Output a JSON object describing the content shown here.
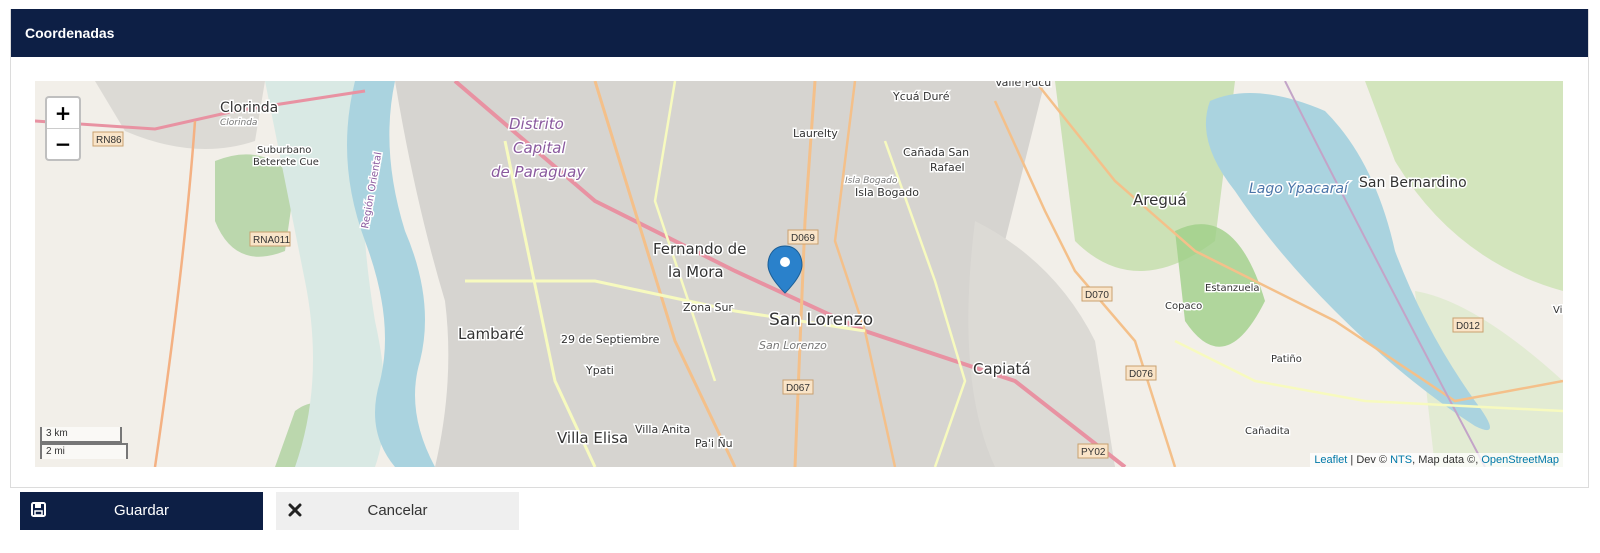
{
  "panel": {
    "title": "Coordenadas"
  },
  "map": {
    "zoom_in": "+",
    "zoom_out": "−",
    "scale_km": "3 km",
    "scale_mi": "2 mi",
    "attribution": {
      "leaflet": "Leaflet",
      "sep1": " | Dev © ",
      "nts": "NTS",
      "map_data": ", Map data ©, ",
      "osm": "OpenStreetMap"
    },
    "places": {
      "clorinda": "Clorinda",
      "clorinda_small": "Clorinda",
      "suburbano": "Suburbano",
      "beterete": "Beterete Cue",
      "distrito1": "Distrito",
      "distrito2": "Capital",
      "distrito3": "de Paraguay",
      "laurelty": "Laurelty",
      "ycua": "Ycuá Duré",
      "valle": "Valle Pucú",
      "canada1": "Cañada San",
      "canada2": "Rafael",
      "isla_small": "Isla Bogado",
      "isla": "Isla Bogado",
      "fdm1": "Fernando de",
      "fdm2": "la Mora",
      "zona_sur": "Zona Sur",
      "san_lorenzo": "San Lorenzo",
      "san_lorenzo_small": "San Lorenzo",
      "lambare": "Lambaré",
      "sep29": "29 de Septiembre",
      "ypati": "Ypati",
      "villa_elisa": "Villa Elisa",
      "villa_anita": "Villa Anita",
      "pai_nu": "Pa'i Ñu",
      "capiata": "Capiatá",
      "aregua": "Areguá",
      "copaco": "Copaco",
      "estanzuela": "Estanzuela",
      "lago": "Lago Ypacaraí",
      "san_bernardino": "San Bernardino",
      "patino": "Patiño",
      "canadita": "Cañadita",
      "region": "Región Oriental",
      "vi": "Vi"
    },
    "roads": {
      "rn86": "RN86",
      "rna011": "RNA011",
      "d069": "D069",
      "d070": "D070",
      "d076": "D076",
      "d067": "D067",
      "d012": "D012",
      "py02": "PY02"
    }
  },
  "buttons": {
    "save": "Guardar",
    "cancel": "Cancelar"
  },
  "colors": {
    "header": "#0d1f45",
    "water": "#aad3df",
    "urban": "#cfcfcf",
    "road_main": "#e892a2",
    "road_yellow": "#f7fabf",
    "marker": "#2a81cb"
  }
}
